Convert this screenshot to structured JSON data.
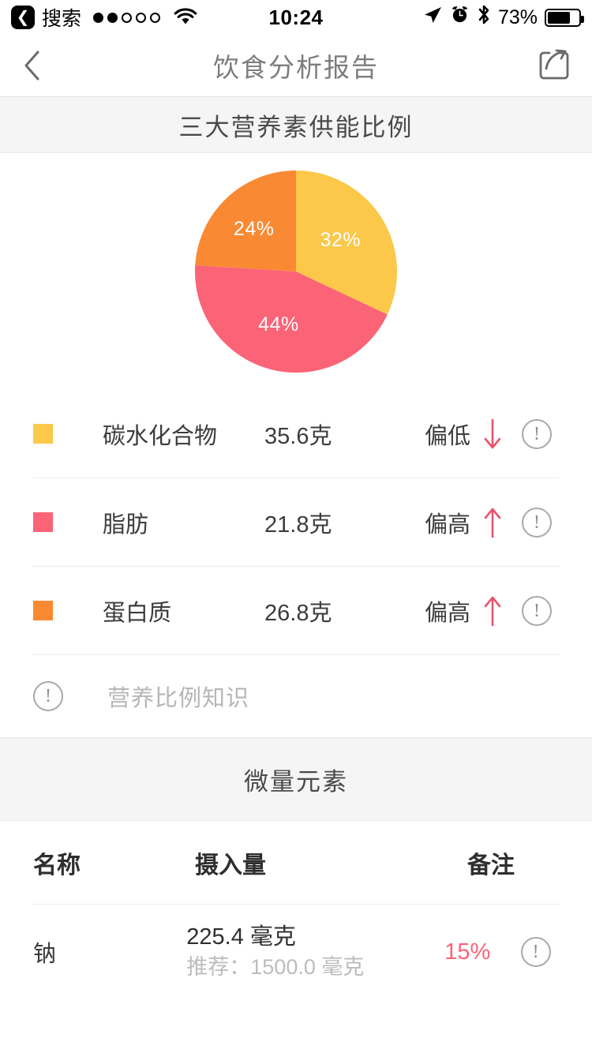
{
  "statusbar": {
    "back_label": "搜索",
    "back_icon": "back-chevron-icon",
    "signal_filled": 2,
    "signal_total": 5,
    "wifi_icon": "wifi-icon",
    "time": "10:24",
    "location_icon": "location-arrow-icon",
    "alarm_icon": "alarm-clock-icon",
    "bluetooth_icon": "bluetooth-icon",
    "battery_percent": "73%",
    "battery_level": 73
  },
  "navbar": {
    "back_icon": "chevron-left-icon",
    "title": "饮食分析报告",
    "share_icon": "share-icon"
  },
  "macro_section": {
    "title": "三大营养素供能比例",
    "knowledge_link": "营养比例知识",
    "knowledge_icon": "info-icon",
    "rows": [
      {
        "color": "#FBC84A",
        "name": "碳水化合物",
        "amount": "35.6克",
        "status": "偏低",
        "trend": "down",
        "trend_icon": "arrow-down-icon",
        "info_icon": "info-icon"
      },
      {
        "color": "#FB6377",
        "name": "脂肪",
        "amount": "21.8克",
        "status": "偏高",
        "trend": "up",
        "trend_icon": "arrow-up-icon",
        "info_icon": "info-icon"
      },
      {
        "color": "#F98A33",
        "name": "蛋白质",
        "amount": "26.8克",
        "status": "偏高",
        "trend": "up",
        "trend_icon": "arrow-up-icon",
        "info_icon": "info-icon"
      }
    ]
  },
  "micro_section": {
    "title": "微量元素",
    "headers": {
      "name": "名称",
      "intake": "摄入量",
      "note": "备注"
    },
    "rows": [
      {
        "name": "钠",
        "intake": "225.4 毫克",
        "recommended": "推荐：1500.0 毫克",
        "percent": "15%",
        "percent_color": "#FB6377",
        "info_icon": "info-icon"
      }
    ]
  },
  "colors": {
    "carb": "#FBC84A",
    "fat": "#FB6377",
    "protein": "#F98A33",
    "accent_pink": "#E8536B",
    "band_bg": "#F5F5F5"
  },
  "chart_data": {
    "type": "pie",
    "title": "三大营养素供能比例",
    "labels": [
      "碳水化合物",
      "脂肪",
      "蛋白质"
    ],
    "values": [
      32,
      44,
      24
    ],
    "value_labels": [
      "32%",
      "44%",
      "24%"
    ],
    "colors": [
      "#FBC84A",
      "#FB6377",
      "#F98A33"
    ],
    "start_angle": 0,
    "direction": "clockwise",
    "legend": "below",
    "grid": false
  }
}
